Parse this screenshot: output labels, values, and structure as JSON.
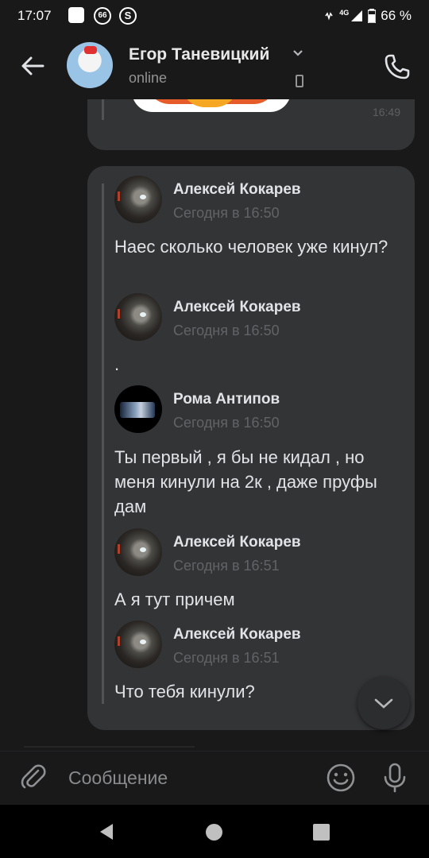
{
  "status_bar": {
    "time": "17:07",
    "network": "4G",
    "battery": "66 %"
  },
  "header": {
    "name": "Егор Таневицкий",
    "status": "online"
  },
  "messages": [
    {
      "time": "16:49"
    },
    {
      "forwarded": [
        {
          "author": "Алексей Кокарев",
          "date": "Сегодня в 16:50",
          "text": "Наес сколько человек уже кинул?"
        },
        {
          "author": "Алексей Кокарев",
          "date": "Сегодня в 16:50",
          "text": "."
        },
        {
          "author": "Рома Антипов",
          "date": "Сегодня в 16:50",
          "text": "Ты первый , я бы не кидал , но меня кинули на 2к , даже пруфы дам"
        },
        {
          "author": "Алексей Кокарев",
          "date": "Сегодня в 16:51",
          "text": "А я тут причем"
        },
        {
          "author": "Алексей Кокарев",
          "date": "Сегодня в 16:51",
          "text": "Что тебя кинули?"
        }
      ]
    }
  ],
  "composer": {
    "placeholder": "Сообщение"
  },
  "icons": {
    "back": "arrow-left-icon",
    "call": "phone-icon",
    "attach": "paperclip-icon",
    "emoji": "smile-icon",
    "voice": "microphone-icon",
    "scroll_down": "chevron-down-icon"
  },
  "colors": {
    "background": "#19191a",
    "bubble": "#333436",
    "text": "#e1e3e6",
    "muted": "#626366"
  }
}
